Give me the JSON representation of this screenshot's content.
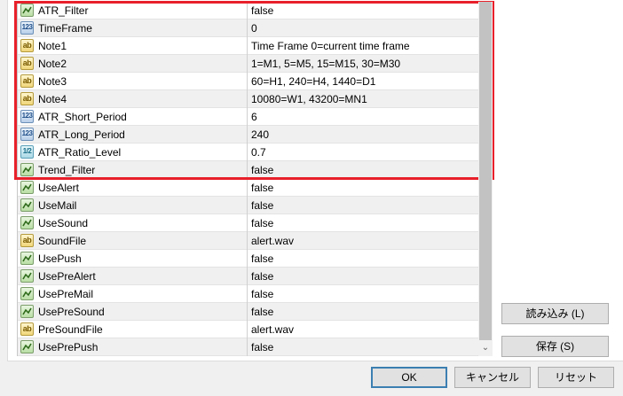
{
  "parameters": [
    {
      "name": "ATR_Filter",
      "value": "false",
      "type": "bool"
    },
    {
      "name": "TimeFrame",
      "value": "0",
      "type": "int"
    },
    {
      "name": "Note1",
      "value": "Time Frame 0=current time frame",
      "type": "string"
    },
    {
      "name": "Note2",
      "value": "1=M1, 5=M5, 15=M15, 30=M30",
      "type": "string"
    },
    {
      "name": "Note3",
      "value": "60=H1, 240=H4, 1440=D1",
      "type": "string"
    },
    {
      "name": "Note4",
      "value": "10080=W1, 43200=MN1",
      "type": "string"
    },
    {
      "name": "ATR_Short_Period",
      "value": "6",
      "type": "int"
    },
    {
      "name": "ATR_Long_Period",
      "value": "240",
      "type": "int"
    },
    {
      "name": "ATR_Ratio_Level",
      "value": "0.7",
      "type": "double"
    },
    {
      "name": "Trend_Filter",
      "value": "false",
      "type": "bool"
    },
    {
      "name": "UseAlert",
      "value": "false",
      "type": "bool"
    },
    {
      "name": "UseMail",
      "value": "false",
      "type": "bool"
    },
    {
      "name": "UseSound",
      "value": "false",
      "type": "bool"
    },
    {
      "name": "SoundFile",
      "value": "alert.wav",
      "type": "string"
    },
    {
      "name": "UsePush",
      "value": "false",
      "type": "bool"
    },
    {
      "name": "UsePreAlert",
      "value": "false",
      "type": "bool"
    },
    {
      "name": "UsePreMail",
      "value": "false",
      "type": "bool"
    },
    {
      "name": "UsePreSound",
      "value": "false",
      "type": "bool"
    },
    {
      "name": "PreSoundFile",
      "value": "alert.wav",
      "type": "string"
    },
    {
      "name": "UsePrePush",
      "value": "false",
      "type": "bool"
    }
  ],
  "icon_labels": {
    "int": "123",
    "string": "ab",
    "double": "1/2"
  },
  "side_buttons": {
    "load_label": "読み込み (L)",
    "save_label": "保存 (S)"
  },
  "dialog_buttons": {
    "ok_label": "OK",
    "cancel_label": "キャンセル",
    "reset_label": "リセット"
  },
  "colors": {
    "highlight": "#e8202a",
    "default_button_border": "#3c7fb1"
  }
}
